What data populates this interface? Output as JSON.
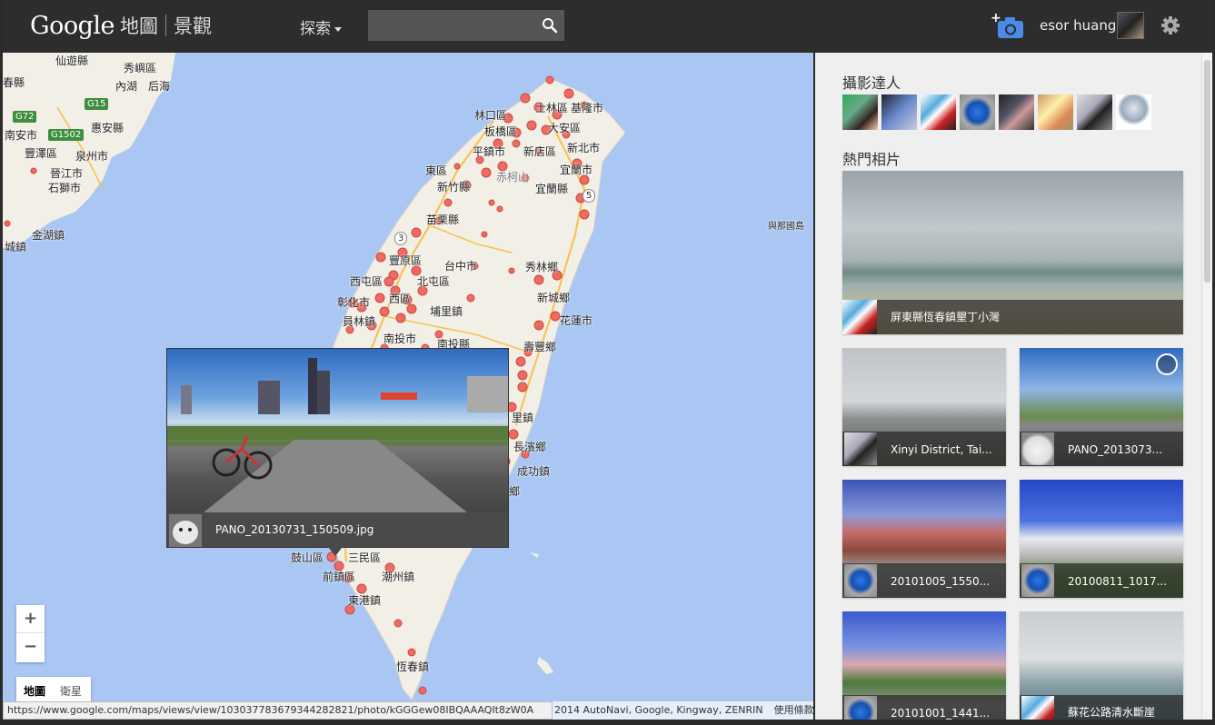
{
  "header": {
    "brand": "Google",
    "maps_label": "地圖",
    "views_label": "景觀",
    "explore_label": "探索",
    "search_placeholder": "",
    "username": "esor huang"
  },
  "map": {
    "labels": [
      {
        "text": "仙遊縣",
        "pos": "a"
      },
      {
        "text": "秀嶼區",
        "pos": "b"
      },
      {
        "text": "春縣",
        "pos": "c"
      },
      {
        "text": "內湖",
        "pos": "d"
      },
      {
        "text": "后海",
        "pos": "e"
      },
      {
        "text": "惠安縣",
        "pos": "f"
      },
      {
        "text": "南安市",
        "pos": "g"
      },
      {
        "text": "豐澤區",
        "pos": "h"
      },
      {
        "text": "泉州市",
        "pos": "i"
      },
      {
        "text": "晉江市",
        "pos": "j"
      },
      {
        "text": "石獅市",
        "pos": "k"
      },
      {
        "text": "金湖鎮",
        "pos": "l"
      },
      {
        "text": "城鎮",
        "pos": "m"
      },
      {
        "text": "林口區",
        "pos": "n"
      },
      {
        "text": "士林區",
        "pos": "o"
      },
      {
        "text": "基隆市",
        "pos": "p"
      },
      {
        "text": "大安區",
        "pos": "q"
      },
      {
        "text": "板橋區",
        "pos": "r"
      },
      {
        "text": "平鎮市",
        "pos": "s"
      },
      {
        "text": "新店區",
        "pos": "t"
      },
      {
        "text": "新北市",
        "pos": "u"
      },
      {
        "text": "東區",
        "pos": "v"
      },
      {
        "text": "赤柯山",
        "pos": "w"
      },
      {
        "text": "宜蘭市",
        "pos": "x"
      },
      {
        "text": "新竹縣",
        "pos": "y"
      },
      {
        "text": "宜蘭縣",
        "pos": "z"
      },
      {
        "text": "苗栗縣",
        "pos": "aa"
      },
      {
        "text": "與那國島",
        "pos": "ab"
      },
      {
        "text": "豐原區",
        "pos": "ac"
      },
      {
        "text": "台中市",
        "pos": "ad"
      },
      {
        "text": "秀林鄉",
        "pos": "ae"
      },
      {
        "text": "西屯區",
        "pos": "af"
      },
      {
        "text": "北屯區",
        "pos": "ag"
      },
      {
        "text": "彰化市",
        "pos": "ah"
      },
      {
        "text": "西區",
        "pos": "ai"
      },
      {
        "text": "新城鄉",
        "pos": "aj"
      },
      {
        "text": "員林鎮",
        "pos": "ak"
      },
      {
        "text": "埔里鎮",
        "pos": "al"
      },
      {
        "text": "花蓮市",
        "pos": "am"
      },
      {
        "text": "南投市",
        "pos": "an"
      },
      {
        "text": "南投縣",
        "pos": "ao"
      },
      {
        "text": "壽豐鄉",
        "pos": "ap"
      },
      {
        "text": "里鎮",
        "pos": "aq"
      },
      {
        "text": "長濱鄉",
        "pos": "ar"
      },
      {
        "text": "成功鎮",
        "pos": "as"
      },
      {
        "text": "鄉",
        "pos": "at"
      },
      {
        "text": "鼓山區",
        "pos": "au"
      },
      {
        "text": "三民區",
        "pos": "av"
      },
      {
        "text": "前鎮區",
        "pos": "aw"
      },
      {
        "text": "潮州鎮",
        "pos": "ax"
      },
      {
        "text": "東港鎮",
        "pos": "ay"
      },
      {
        "text": "恆春鎮",
        "pos": "az"
      }
    ],
    "shields": [
      "G72",
      "G15",
      "G1502",
      "3",
      "5"
    ],
    "popup_caption": "PANO_20130731_150509.jpg",
    "zoom_in": "+",
    "zoom_out": "−",
    "maptype_map": "地圖",
    "maptype_satellite": "衛星",
    "status_url": "https://www.google.com/maps/views/view/103037783679344282821/photo/kGGGew08IBQAAAQIt8zW0A",
    "copyright": "2014 AutoNavi, Google, Kingway, ZENRIN",
    "terms": "使用條款"
  },
  "sidebar": {
    "photographers_title": "攝影達人",
    "popular_title": "熱門相片",
    "cards": [
      {
        "title": "屏東縣恆春鎮墾丁小灣"
      },
      {
        "title": "Xinyi District, Tai..."
      },
      {
        "title": "PANO_2013073..."
      },
      {
        "title": "20101005_1550..."
      },
      {
        "title": "20100811_1017..."
      },
      {
        "title": "20101001_1441..."
      },
      {
        "title": "蘇花公路清水斷崖"
      }
    ]
  },
  "colors": {
    "header_bg": "#2d2d2d",
    "map_water": "#aac7f4",
    "land": "#f2efe6",
    "marker": "#ef6a61",
    "camera_blue": "#4a8ae8"
  }
}
